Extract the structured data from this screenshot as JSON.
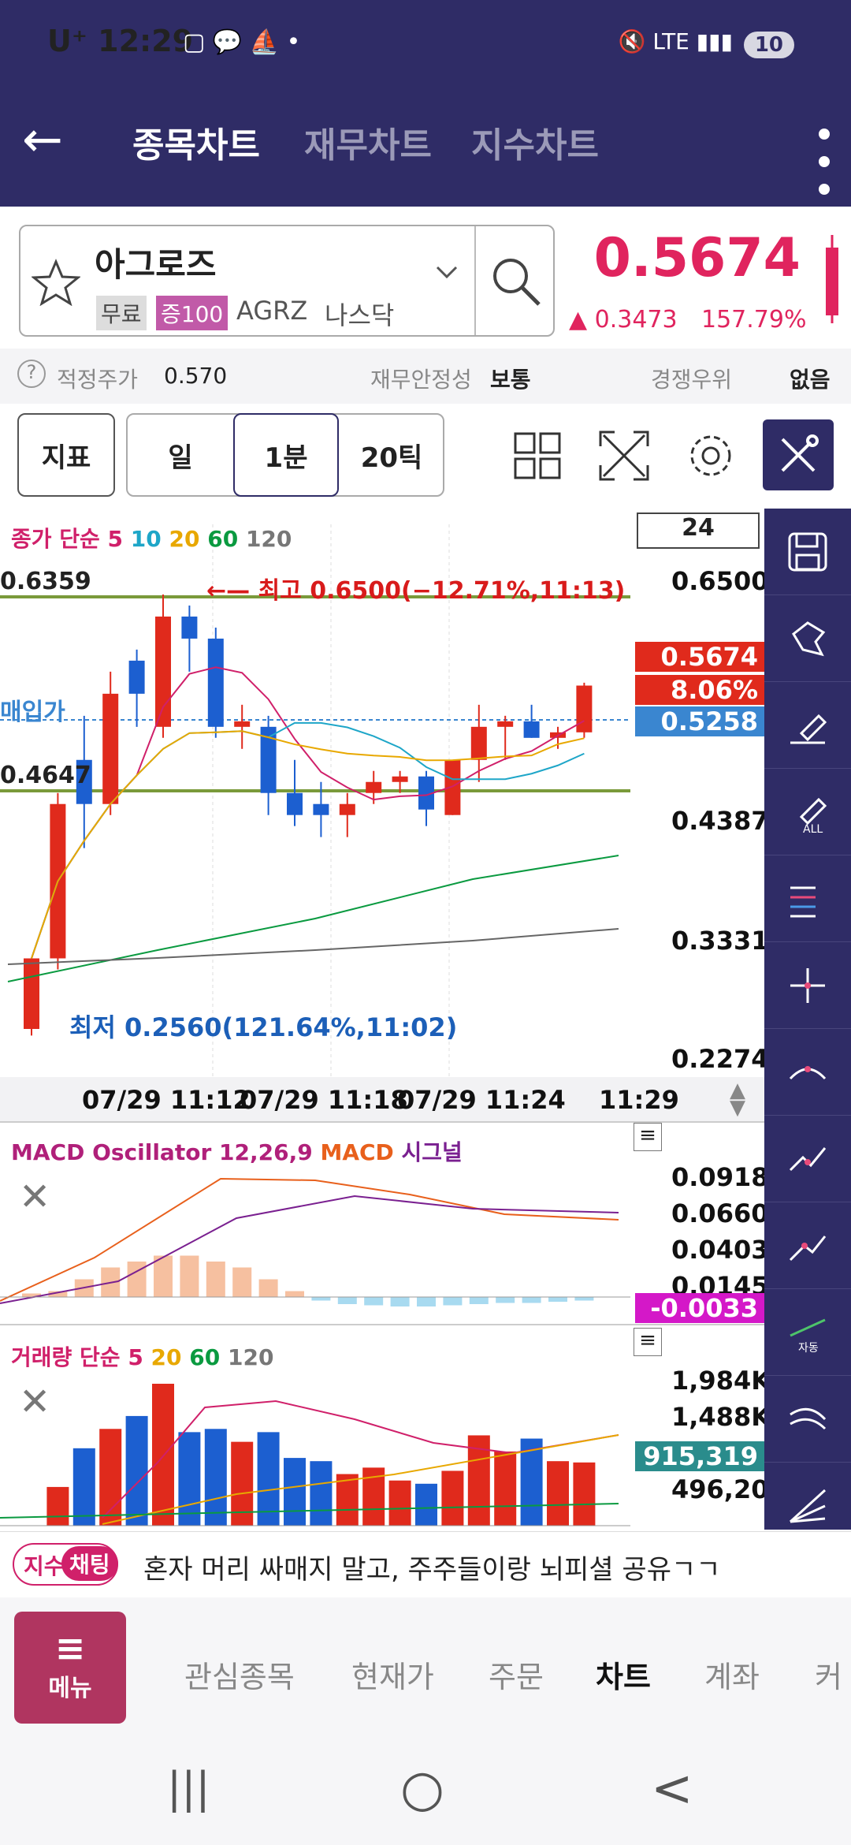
{
  "status": {
    "carrier": "U⁺",
    "time": "12:29",
    "icons": "▢ 💬 ⛵ •",
    "right_icons": "🔇 LTE ▮▮▮",
    "battery": "10"
  },
  "header": {
    "tabs": [
      "종목차트",
      "재무차트",
      "지수차트"
    ],
    "back": "←"
  },
  "stock": {
    "name": "아그로즈",
    "tag_free": "무료",
    "tag_margin": "증100",
    "ticker": "AGRZ",
    "market": "나스닥",
    "price": "0.5674",
    "change": "▲ 0.3473",
    "change_pct": "157.79%"
  },
  "info": {
    "fair_label": "적정주가",
    "fair_value": "0.570",
    "stability_label": "재무안정성",
    "stability_value": "보통",
    "advantage_label": "경쟁우위",
    "advantage_value": "없음"
  },
  "toolbar": {
    "indicator": "지표",
    "day": "일",
    "interval": "1분",
    "tick": "20틱"
  },
  "chart": {
    "legend_label": "종가 단순",
    "legend_periods": [
      "5",
      "10",
      "20",
      "60",
      "120"
    ],
    "period_box": "24",
    "high_note": "←— 최고 0.6500(−12.71%,11:13)",
    "low_note": "최저 0.2560(121.64%,11:02)",
    "line1_label": "0.6359",
    "line2_label": "0.4647",
    "avg_label": "매입가",
    "y_ticks": [
      "0.6500",
      "0.4387",
      "0.3331",
      "0.2274"
    ],
    "price_tag": "0.5674",
    "pct_tag": "8.06%",
    "avg_tag": "0.5258",
    "x_ticks": [
      "07/29 11:12",
      "07/29 11:18",
      "07/29 11:24",
      "11:29"
    ],
    "macd_title": "MACD Oscillator 12,26,9",
    "macd_label": "MACD",
    "signal_label": "시그널",
    "macd_ticks": [
      "0.0918",
      "0.0660",
      "0.0403",
      "0.0145"
    ],
    "macd_tag": "-0.0033",
    "vol_title": "거래량 단순",
    "vol_periods": [
      "5",
      "20",
      "60",
      "120"
    ],
    "vol_ticks": [
      "1,984K",
      "1,488K",
      "496,202"
    ],
    "vol_tag": "915,319"
  },
  "chart_data": {
    "type": "candlestick",
    "candles": [
      {
        "o": 0.256,
        "h": 0.27,
        "l": 0.25,
        "c": 0.32,
        "up": true
      },
      {
        "o": 0.32,
        "h": 0.47,
        "l": 0.31,
        "c": 0.46,
        "up": true
      },
      {
        "o": 0.46,
        "h": 0.54,
        "l": 0.42,
        "c": 0.5,
        "up": false
      },
      {
        "o": 0.46,
        "h": 0.58,
        "l": 0.45,
        "c": 0.56,
        "up": true
      },
      {
        "o": 0.56,
        "h": 0.6,
        "l": 0.53,
        "c": 0.59,
        "up": false
      },
      {
        "o": 0.53,
        "h": 0.65,
        "l": 0.52,
        "c": 0.63,
        "up": true
      },
      {
        "o": 0.63,
        "h": 0.64,
        "l": 0.58,
        "c": 0.61,
        "up": false
      },
      {
        "o": 0.61,
        "h": 0.62,
        "l": 0.52,
        "c": 0.53,
        "up": false
      },
      {
        "o": 0.53,
        "h": 0.55,
        "l": 0.51,
        "c": 0.535,
        "up": true
      },
      {
        "o": 0.53,
        "h": 0.54,
        "l": 0.45,
        "c": 0.47,
        "up": false
      },
      {
        "o": 0.47,
        "h": 0.5,
        "l": 0.44,
        "c": 0.45,
        "up": false
      },
      {
        "o": 0.45,
        "h": 0.48,
        "l": 0.43,
        "c": 0.46,
        "up": false
      },
      {
        "o": 0.45,
        "h": 0.47,
        "l": 0.43,
        "c": 0.46,
        "up": true
      },
      {
        "o": 0.47,
        "h": 0.49,
        "l": 0.46,
        "c": 0.48,
        "up": true
      },
      {
        "o": 0.48,
        "h": 0.49,
        "l": 0.47,
        "c": 0.485,
        "up": true
      },
      {
        "o": 0.485,
        "h": 0.49,
        "l": 0.44,
        "c": 0.455,
        "up": false
      },
      {
        "o": 0.45,
        "h": 0.5,
        "l": 0.45,
        "c": 0.5,
        "up": true
      },
      {
        "o": 0.5,
        "h": 0.55,
        "l": 0.48,
        "c": 0.53,
        "up": true
      },
      {
        "o": 0.53,
        "h": 0.54,
        "l": 0.5,
        "c": 0.535,
        "up": true
      },
      {
        "o": 0.535,
        "h": 0.55,
        "l": 0.52,
        "c": 0.52,
        "up": false
      },
      {
        "o": 0.52,
        "h": 0.53,
        "l": 0.51,
        "c": 0.525,
        "up": true
      },
      {
        "o": 0.525,
        "h": 0.57,
        "l": 0.52,
        "c": 0.5674,
        "up": true
      }
    ],
    "ylim": [
      0.2274,
      0.65
    ],
    "volume": [
      0,
      600,
      1200,
      1500,
      1700,
      2200,
      1450,
      1500,
      1300,
      1450,
      1050,
      1000,
      800,
      900,
      700,
      650,
      850,
      1400,
      1150,
      1350,
      1000,
      980
    ],
    "macd_hist": [
      0.003,
      0.005,
      0.015,
      0.025,
      0.03,
      0.035,
      0.035,
      0.03,
      0.025,
      0.015,
      0.005,
      -0.003,
      -0.006,
      -0.007,
      -0.008,
      -0.008,
      -0.007,
      -0.006,
      -0.005,
      -0.005,
      -0.004,
      -0.003
    ]
  },
  "chat": {
    "tag1": "지수",
    "tag2": "채팅",
    "message": "혼자 머리 싸매지 말고, 주주들이랑 뇌피셜 공유ㄱㄱ"
  },
  "nav": {
    "menu": "메뉴",
    "items": [
      "관심종목",
      "현재가",
      "주문",
      "차트",
      "계좌",
      "커"
    ]
  },
  "sysnav": {
    "recent": "|||",
    "home": "○",
    "back": "<"
  }
}
